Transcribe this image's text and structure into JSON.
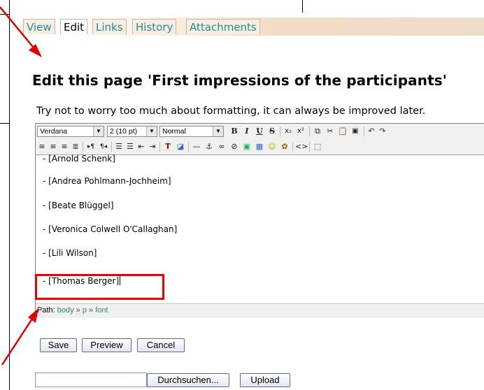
{
  "tabs": [
    {
      "label": "View"
    },
    {
      "label": "Edit"
    },
    {
      "label": "Links"
    },
    {
      "label": "History"
    },
    {
      "label": "Attachments"
    }
  ],
  "page_title": "Edit this page 'First impressions of the participants'",
  "intro_text": "Try not to worry too much about formatting, it can always be improved later.",
  "toolbar": {
    "font_select": "Verdana",
    "size_select": "2 (10 pt)",
    "format_select": "Normal"
  },
  "content_lines": [
    "- [Arnold Schenk]",
    "- [Andrea Pohlmann-Jochheim]",
    "- [Beate Blüggel]",
    "- [Veronica Colwell O'Callaghan]",
    "- [Lili Wilson]",
    "- [Thomas Berger]"
  ],
  "path": {
    "label": "Path:",
    "items": [
      "body",
      "p",
      "font"
    ],
    "separator": "»"
  },
  "buttons": {
    "save": "Save",
    "preview": "Preview",
    "cancel": "Cancel",
    "browse": "Durchsuchen...",
    "upload": "Upload"
  },
  "colors": {
    "link": "#2a8a8a",
    "annotation": "#e00000"
  }
}
